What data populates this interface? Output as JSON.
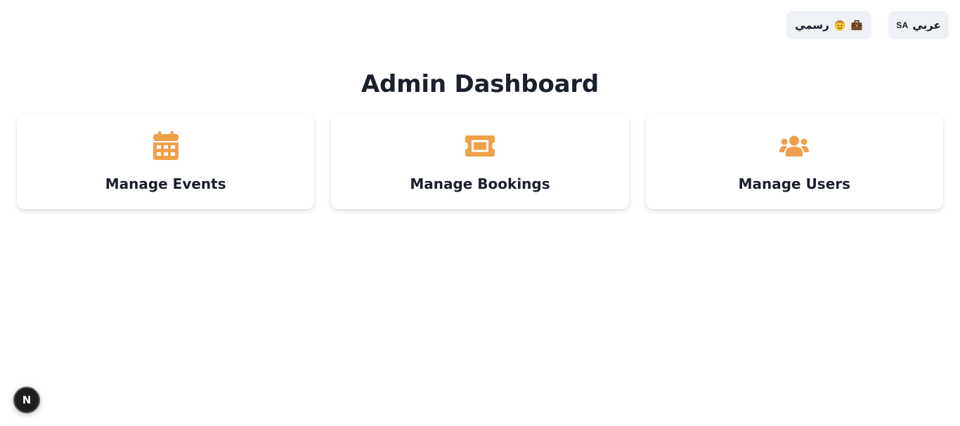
{
  "topbar": {
    "language_button": {
      "label": "عربي",
      "region": "SA"
    },
    "style_button": {
      "label": "رسمي",
      "icons": [
        "child-face-emoji-icon",
        "briefcase-emoji-icon"
      ]
    }
  },
  "page": {
    "title": "Admin Dashboard"
  },
  "cards": [
    {
      "label": "Manage Events",
      "icon": "calendar-icon"
    },
    {
      "label": "Manage Bookings",
      "icon": "ticket-icon"
    },
    {
      "label": "Manage Users",
      "icon": "users-icon"
    }
  ],
  "dev_badge": {
    "label": "N"
  },
  "colors": {
    "accent": "#f0a04b",
    "heading": "#1a202c",
    "pill_bg": "#eef2f6",
    "badge_bg": "#1e1e1e"
  }
}
